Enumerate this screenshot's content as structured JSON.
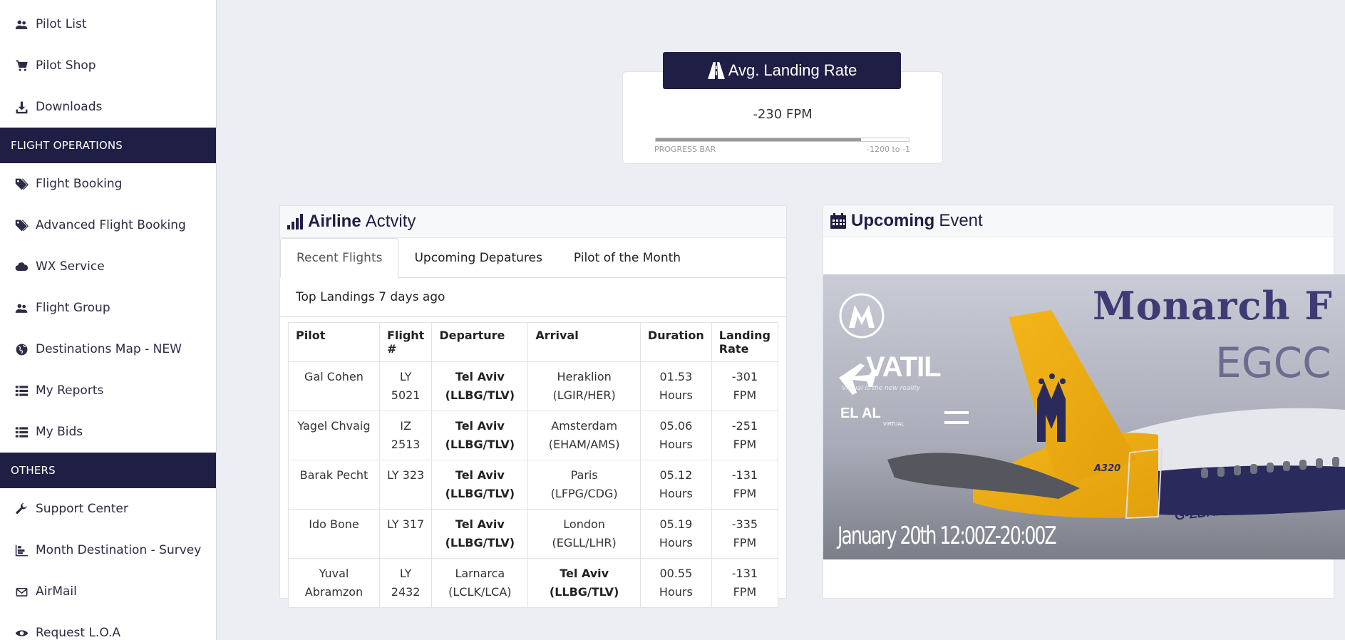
{
  "sidebar": {
    "items_top": [
      {
        "label": "Pilot List",
        "icon": "users-icon"
      },
      {
        "label": "Pilot Shop",
        "icon": "cart-icon"
      },
      {
        "label": "Downloads",
        "icon": "download-icon"
      }
    ],
    "section_flight_ops": "FLIGHT OPERATIONS",
    "items_ops": [
      {
        "label": "Flight Booking",
        "icon": "tags-icon"
      },
      {
        "label": "Advanced Flight Booking",
        "icon": "tags-icon"
      },
      {
        "label": "WX Service",
        "icon": "cloud-icon"
      },
      {
        "label": "Flight Group",
        "icon": "users-icon"
      },
      {
        "label": "Destinations Map - NEW",
        "icon": "globe-icon"
      },
      {
        "label": "My Reports",
        "icon": "list-icon"
      },
      {
        "label": "My Bids",
        "icon": "list-icon"
      }
    ],
    "section_others": "OTHERS",
    "items_others": [
      {
        "label": "Support Center",
        "icon": "wrench-icon"
      },
      {
        "label": "Month Destination - Survey",
        "icon": "chart-icon"
      },
      {
        "label": "AirMail",
        "icon": "envelope-icon"
      },
      {
        "label": "Request L.O.A",
        "icon": "eye-icon"
      }
    ]
  },
  "landing_rate": {
    "title": "Avg. Landing Rate",
    "value": "-230 FPM",
    "progress_label": "PROGRESS BAR",
    "range_label": "-1200 to -1",
    "progress_fraction": 0.81
  },
  "activity": {
    "title_bold": "Airline",
    "title_rest": "Actvity",
    "tabs": [
      "Recent Flights",
      "Upcoming Depatures",
      "Pilot of the Month"
    ],
    "subtitle": "Top Landings 7 days ago",
    "columns": [
      "Pilot",
      "Flight #",
      "Departure",
      "Arrival",
      "Duration",
      "Landing Rate"
    ],
    "rows": [
      [
        "Gal Cohen",
        "LY 5021",
        "Tel Aviv (LLBG/TLV)",
        "Heraklion (LGIR/HER)",
        "01.53 Hours",
        "-301 FPM"
      ],
      [
        "Yagel Chvaig",
        "IZ 2513",
        "Tel Aviv (LLBG/TLV)",
        "Amsterdam (EHAM/AMS)",
        "05.06 Hours",
        "-251 FPM"
      ],
      [
        "Barak Pecht",
        "LY 323",
        "Tel Aviv (LLBG/TLV)",
        "Paris (LFPG/CDG)",
        "05.12 Hours",
        "-131 FPM"
      ],
      [
        "Ido Bone",
        "LY 317",
        "Tel Aviv (LLBG/TLV)",
        "London (EGLL/LHR)",
        "05.19 Hours",
        "-335 FPM"
      ],
      [
        "Yuval Abramzon",
        "LY 2432",
        "Larnarca (LCLK/LCA)",
        "Tel Aviv (LLBG/TLV)",
        "00.55 Hours",
        "-131 FPM"
      ]
    ]
  },
  "event": {
    "title_bold": "Upcoming",
    "title_rest": "Event",
    "banner": {
      "headline": "Monarch F",
      "route": "EGCC - LL",
      "date_text": "January 20th 12:00Z-20:00Z",
      "logo_vatil": "VATIL",
      "vatil_tagline": "Virtual is the new reality",
      "logo_elal": "EL AL",
      "elal_sub": "VIRTUAL",
      "aircraft_type": "A320",
      "registration": "G-ZBAP"
    }
  }
}
